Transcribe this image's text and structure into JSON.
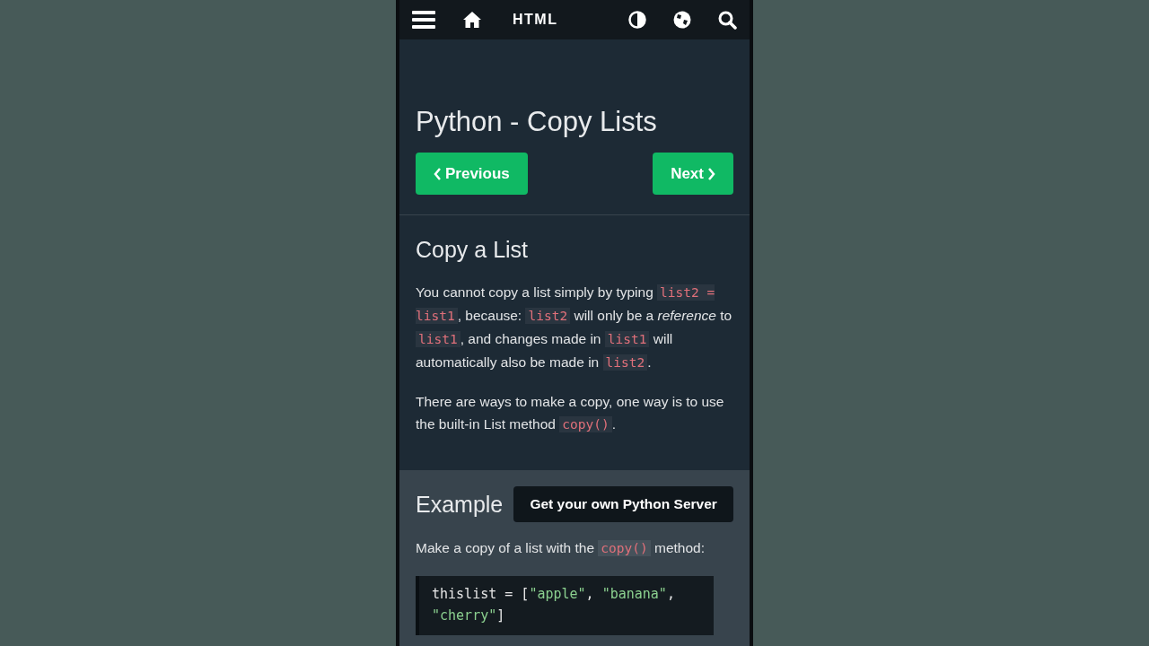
{
  "navbar": {
    "brand": "HTML"
  },
  "title": "Python - Copy Lists",
  "pager": {
    "previous": "Previous",
    "next": "Next"
  },
  "section": {
    "heading": "Copy a List",
    "paragraphs": [
      [
        {
          "kind": "text",
          "text": "You cannot copy a list simply by typing "
        },
        {
          "kind": "code",
          "text": "list2 = list1"
        },
        {
          "kind": "text",
          "text": ", because: "
        },
        {
          "kind": "code",
          "text": "list2"
        },
        {
          "kind": "text",
          "text": " will only be a "
        },
        {
          "kind": "em",
          "text": "reference"
        },
        {
          "kind": "text",
          "text": " to "
        },
        {
          "kind": "code",
          "text": "list1"
        },
        {
          "kind": "text",
          "text": ", and changes made in "
        },
        {
          "kind": "code",
          "text": "list1"
        },
        {
          "kind": "text",
          "text": " will automatically also be made in "
        },
        {
          "kind": "code",
          "text": "list2"
        },
        {
          "kind": "text",
          "text": "."
        }
      ],
      [
        {
          "kind": "text",
          "text": "There are ways to make a copy, one way is to use the built-in List method "
        },
        {
          "kind": "code",
          "text": "copy()"
        },
        {
          "kind": "text",
          "text": "."
        }
      ]
    ]
  },
  "example": {
    "heading": "Example",
    "server_button": "Get your own Python Server",
    "intro": [
      {
        "kind": "text",
        "text": "Make a copy of a list with the "
      },
      {
        "kind": "code",
        "text": "copy()"
      },
      {
        "kind": "text",
        "text": " method:"
      }
    ],
    "code": [
      [
        {
          "kind": "plain",
          "text": "thislist = ["
        },
        {
          "kind": "string",
          "text": "\"apple\""
        },
        {
          "kind": "plain",
          "text": ", "
        },
        {
          "kind": "string",
          "text": "\"banana\""
        },
        {
          "kind": "plain",
          "text": ", "
        },
        {
          "kind": "string",
          "text": "\"cherry\""
        },
        {
          "kind": "plain",
          "text": "]"
        }
      ]
    ]
  }
}
